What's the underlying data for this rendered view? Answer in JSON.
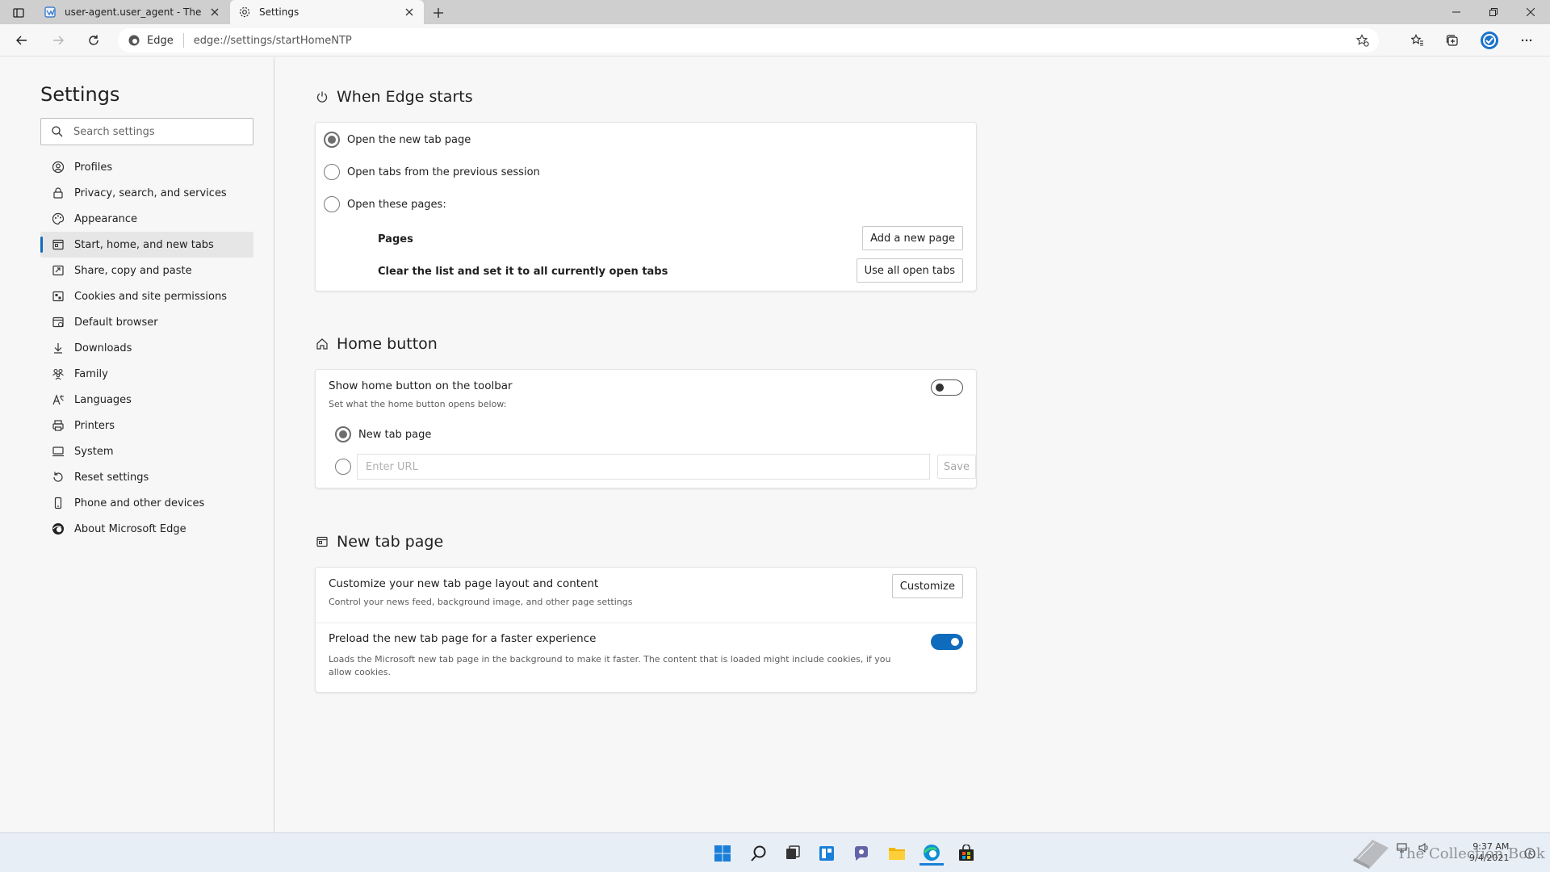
{
  "tabs": [
    {
      "title": "user-agent.user_agent - The Coll",
      "icon": "document-globe-icon"
    },
    {
      "title": "Settings",
      "icon": "gear-icon",
      "active": true
    }
  ],
  "toolbar": {
    "site_label": "Edge",
    "url": "edge://settings/startHomeNTP"
  },
  "nav": {
    "title": "Settings",
    "search_placeholder": "Search settings",
    "items": [
      {
        "label": "Profiles",
        "icon": "profile-icon"
      },
      {
        "label": "Privacy, search, and services",
        "icon": "lock-icon"
      },
      {
        "label": "Appearance",
        "icon": "palette-icon"
      },
      {
        "label": "Start, home, and new tabs",
        "icon": "start-tabs-icon",
        "active": true
      },
      {
        "label": "Share, copy and paste",
        "icon": "share-icon"
      },
      {
        "label": "Cookies and site permissions",
        "icon": "cookies-icon"
      },
      {
        "label": "Default browser",
        "icon": "default-browser-icon"
      },
      {
        "label": "Downloads",
        "icon": "download-icon"
      },
      {
        "label": "Family",
        "icon": "family-icon"
      },
      {
        "label": "Languages",
        "icon": "languages-icon"
      },
      {
        "label": "Printers",
        "icon": "printer-icon"
      },
      {
        "label": "System",
        "icon": "system-icon"
      },
      {
        "label": "Reset settings",
        "icon": "reset-icon"
      },
      {
        "label": "Phone and other devices",
        "icon": "phone-icon"
      },
      {
        "label": "About Microsoft Edge",
        "icon": "edge-logo-icon"
      }
    ]
  },
  "startup": {
    "title": "When Edge starts",
    "options": [
      "Open the new tab page",
      "Open tabs from the previous session",
      "Open these pages:"
    ],
    "selected": 0,
    "pages_label": "Pages",
    "add_page_button": "Add a new page",
    "clear_label": "Clear the list and set it to all currently open tabs",
    "use_all_button": "Use all open tabs"
  },
  "home": {
    "title": "Home button",
    "show_label": "Show home button on the toolbar",
    "show_sub": "Set what the home button opens below:",
    "toggle_on": false,
    "option_new_tab": "New tab page",
    "url_placeholder": "Enter URL",
    "save_button": "Save"
  },
  "ntp": {
    "title": "New tab page",
    "customize_label": "Customize your new tab page layout and content",
    "customize_sub": "Control your news feed, background image, and other page settings",
    "customize_button": "Customize",
    "preload_label": "Preload the new tab page for a faster experience",
    "preload_sub": "Loads the Microsoft new tab page in the background to make it faster. The content that is loaded might include cookies, if you allow cookies.",
    "preload_on": true
  },
  "taskbar": {
    "time": "9:37 AM",
    "date": "9/4/2021",
    "watermark": "The Collection Book"
  },
  "colors": {
    "accent": "#0f6cbd",
    "taskbar": "#e8eef6"
  }
}
